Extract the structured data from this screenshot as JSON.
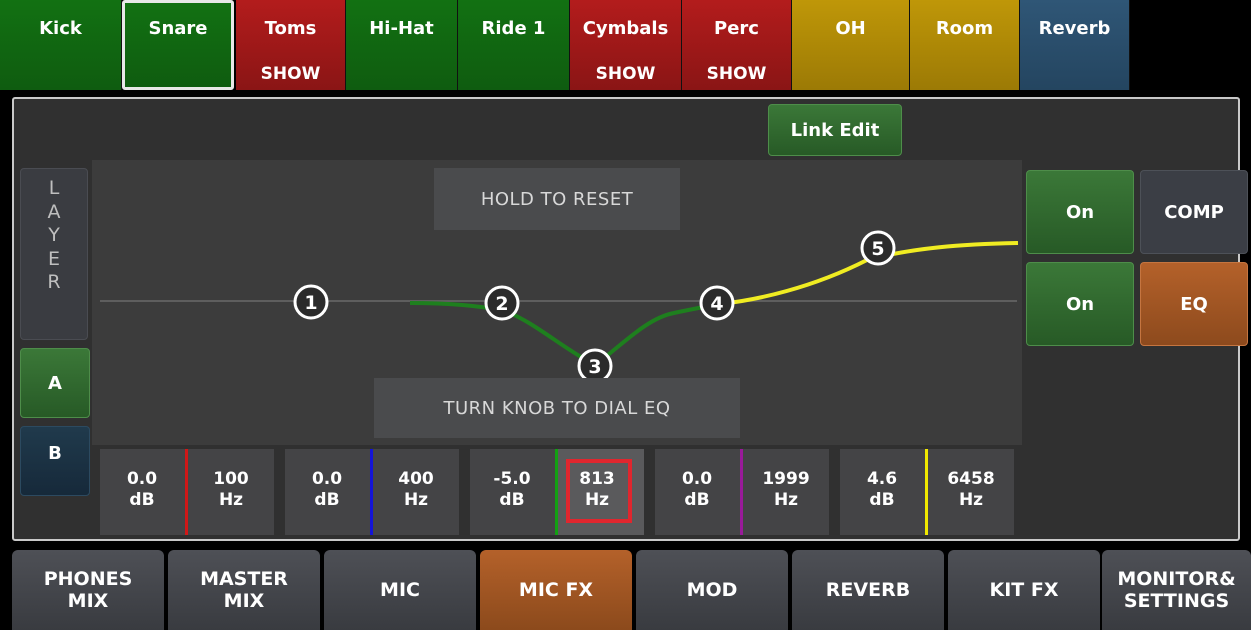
{
  "channels": [
    {
      "name": "Kick",
      "show": "",
      "color": "#127112"
    },
    {
      "name": "Snare",
      "show": "",
      "color": "#127112",
      "selected": true
    },
    {
      "name": "Toms",
      "show": "SHOW",
      "color": "#b31c1c"
    },
    {
      "name": "Hi-Hat",
      "show": "",
      "color": "#127112"
    },
    {
      "name": "Ride 1",
      "show": "",
      "color": "#127112"
    },
    {
      "name": "Cymbals",
      "show": "SHOW",
      "color": "#b31c1c"
    },
    {
      "name": "Perc",
      "show": "SHOW",
      "color": "#b31c1c"
    },
    {
      "name": "OH",
      "show": "",
      "color": "#bf9708"
    },
    {
      "name": "Room",
      "show": "",
      "color": "#bf9708"
    },
    {
      "name": "Reverb",
      "show": "",
      "color": "#2f5676"
    }
  ],
  "link_edit": "Link Edit",
  "layer": {
    "label": "LAYER",
    "a": "A",
    "b": "B",
    "active": "A"
  },
  "hints": {
    "reset": "HOLD TO RESET",
    "dial": "TURN KNOB TO DIAL EQ"
  },
  "eq_nodes": [
    "1",
    "2",
    "3",
    "4",
    "5"
  ],
  "bands": [
    {
      "gain": "0.0",
      "gain_unit": "dB",
      "freq": "100",
      "freq_unit": "Hz",
      "color": "#d01818"
    },
    {
      "gain": "0.0",
      "gain_unit": "dB",
      "freq": "400",
      "freq_unit": "Hz",
      "color": "#1414d8"
    },
    {
      "gain": "-5.0",
      "gain_unit": "dB",
      "freq": "813",
      "freq_unit": "Hz",
      "color": "#12a012",
      "selected": true
    },
    {
      "gain": "0.0",
      "gain_unit": "dB",
      "freq": "1999",
      "freq_unit": "Hz",
      "color": "#9a1a9a"
    },
    {
      "gain": "4.6",
      "gain_unit": "dB",
      "freq": "6458",
      "freq_unit": "Hz",
      "color": "#f0e800"
    }
  ],
  "right": {
    "comp_on": "On",
    "comp": "COMP",
    "eq_on": "On",
    "eq": "EQ"
  },
  "nav": [
    {
      "label": "PHONES\nMIX"
    },
    {
      "label": "MASTER\nMIX"
    },
    {
      "label": "MIC"
    },
    {
      "label": "MIC FX",
      "active": true
    },
    {
      "label": "MOD"
    },
    {
      "label": "REVERB"
    },
    {
      "label": "KIT FX"
    },
    {
      "label": "MONITOR&\nSETTINGS"
    }
  ]
}
